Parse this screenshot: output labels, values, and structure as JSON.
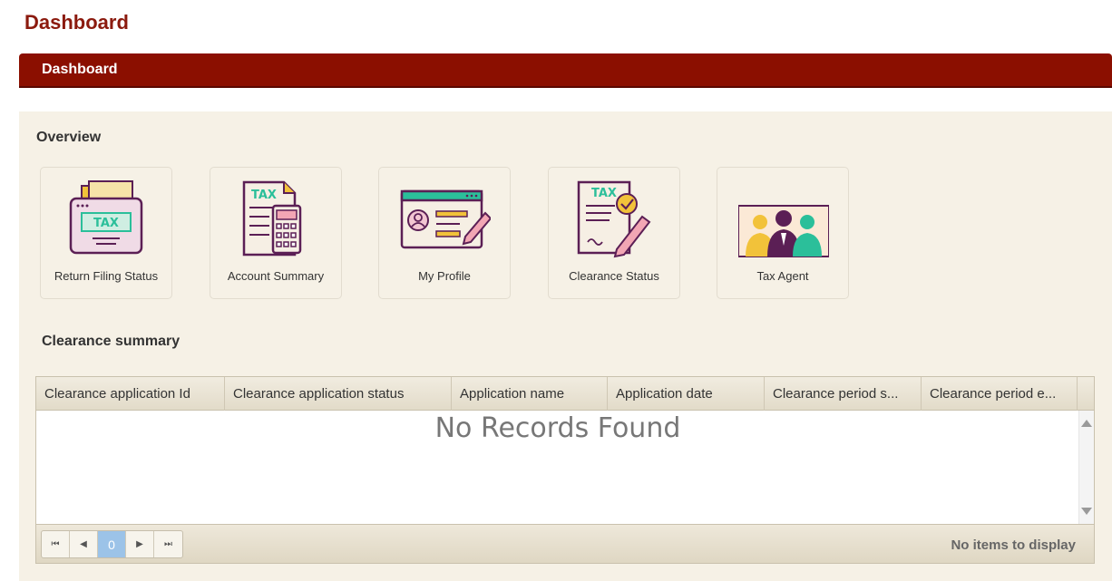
{
  "page": {
    "title": "Dashboard"
  },
  "banner": {
    "title": "Dashboard"
  },
  "overview": {
    "title": "Overview",
    "tiles": [
      {
        "label": "Return Filing Status",
        "icon": "tax-folder-icon",
        "badge": "TAX"
      },
      {
        "label": "Account Summary",
        "icon": "tax-calculator-icon",
        "badge": "TAX"
      },
      {
        "label": "My Profile",
        "icon": "profile-card-icon"
      },
      {
        "label": "Clearance Status",
        "icon": "tax-clearance-icon",
        "badge": "TAX"
      },
      {
        "label": "Tax Agent",
        "icon": "agents-icon"
      }
    ]
  },
  "clearance": {
    "title": "Clearance summary",
    "columns": [
      "Clearance application Id",
      "Clearance application status",
      "Application name",
      "Application date",
      "Clearance period s...",
      "Clearance period e..."
    ],
    "empty_message": "No Records Found",
    "pager": {
      "current_page": "0",
      "first_glyph": "⏮",
      "prev_glyph": "◀",
      "next_glyph": "▶",
      "last_glyph": "⏭",
      "info": "No items to display"
    }
  },
  "colors": {
    "brand": "#8b0f00",
    "panel": "#f6f1e6",
    "accent_teal": "#2bbf9a",
    "accent_yellow": "#f2c23a",
    "icon_outline": "#5b1f55"
  }
}
